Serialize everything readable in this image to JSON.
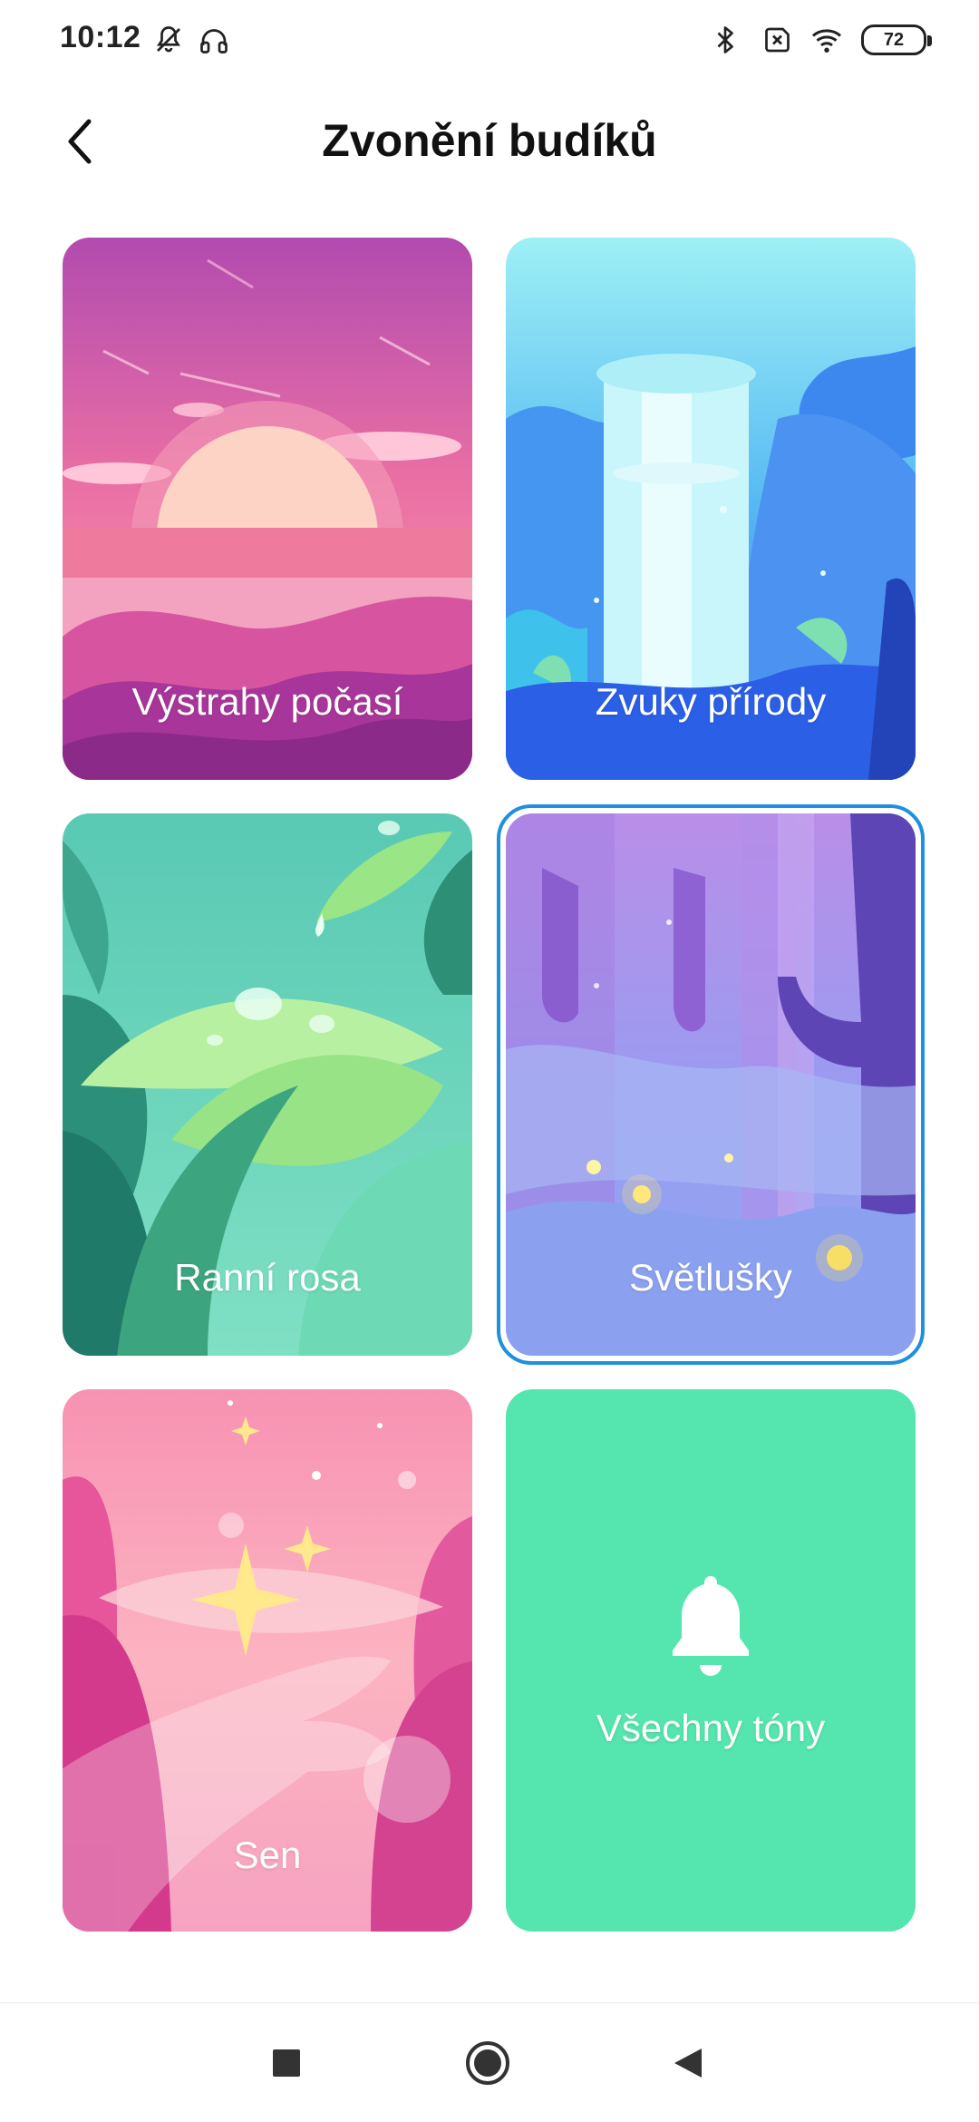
{
  "status_bar": {
    "time": "10:12",
    "left_icons": [
      "bell-off-icon",
      "headphones-icon"
    ],
    "right_icons": [
      "bluetooth-icon",
      "sim-off-icon",
      "wifi-icon"
    ],
    "battery": "72"
  },
  "header": {
    "back_icon": "chevron-left-icon",
    "title": "Zvonění budíků"
  },
  "cards": [
    {
      "label": "Výstrahy počasí",
      "theme": "sunset-pink"
    },
    {
      "label": "Zvuky přírody",
      "theme": "waterfall-blue"
    },
    {
      "label": "Ranní rosa",
      "theme": "leaves-green"
    },
    {
      "label": "Světlušky",
      "theme": "forest-purple",
      "selected": true
    },
    {
      "label": "Sen",
      "theme": "dream-pink"
    },
    {
      "label": "Všechny tóny",
      "theme": "solid-green",
      "icon": "bell-icon"
    }
  ],
  "colors": {
    "accent_selected": "#1f8fe0",
    "all_tones_bg": "#55e5ae"
  },
  "nav_bar": {
    "buttons": [
      "recent-apps-icon",
      "home-icon",
      "back-triangle-icon"
    ]
  }
}
